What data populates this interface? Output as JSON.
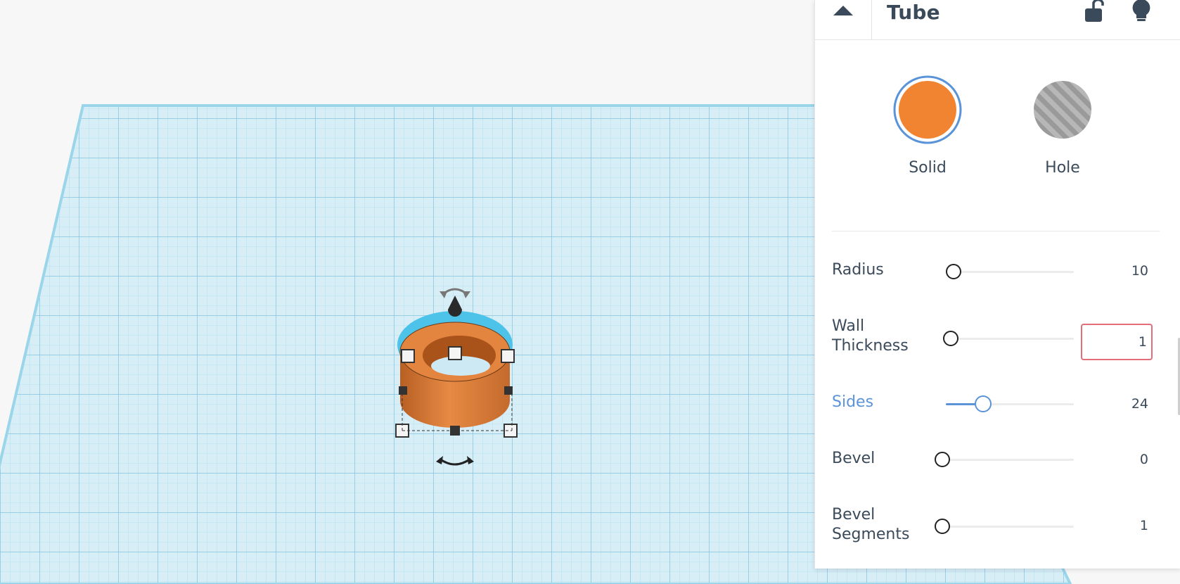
{
  "inspector": {
    "title": "Tube",
    "collapse_icon": "caret-up-icon",
    "lock_icon": "unlocked-padlock-icon",
    "hint_icon": "lightbulb-icon",
    "solid": {
      "label": "Solid",
      "color": "#f08431",
      "selected": true
    },
    "hole": {
      "label": "Hole",
      "selected": false
    },
    "properties": [
      {
        "label": "Radius",
        "value": "10",
        "level": 0.0
      },
      {
        "label": "Wall Thickness",
        "value": "1",
        "level": 0.0
      },
      {
        "label": "Sides",
        "value": "24",
        "level": 0.3
      },
      {
        "label": "Bevel",
        "value": "0",
        "level": 0.0
      },
      {
        "label": "Bevel Segments",
        "value": "1",
        "level": 0.0
      }
    ]
  },
  "colors": {
    "accent": "#5b93d9",
    "text": "#3b4a5a",
    "grid": "#c2e6f2",
    "shape_orange": "#e0803d",
    "input_error_border": "#e36d78"
  }
}
